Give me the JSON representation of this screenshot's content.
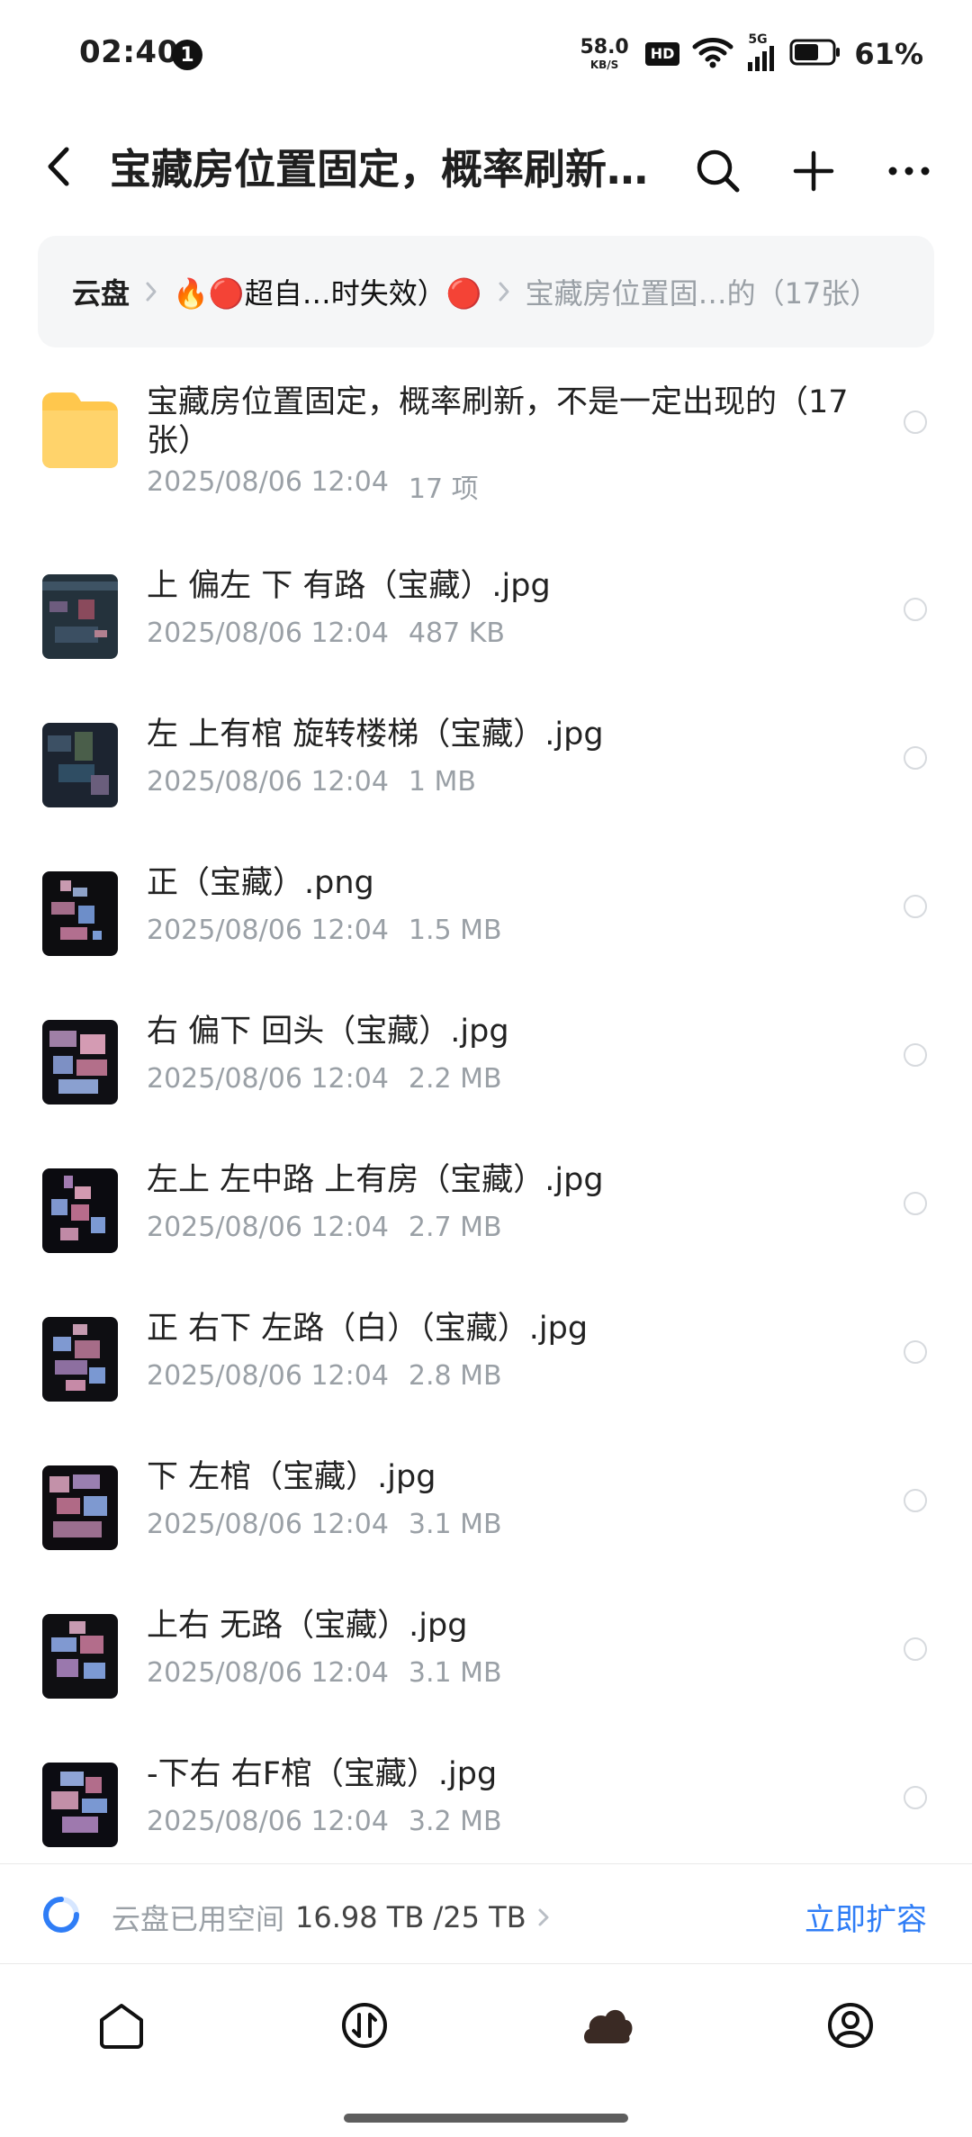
{
  "status_bar": {
    "time": "02:40",
    "notification_badge": "1",
    "net_speed_value": "58.0",
    "net_speed_unit": "KB/S",
    "hd_badge": "HD",
    "cellular_label": "5G",
    "battery_percent": "61%"
  },
  "header": {
    "title": "宝藏房位置固定，概率刷新…",
    "icons": {
      "back": "back-chevron-icon",
      "search": "search-icon",
      "add": "plus-icon",
      "more": "more-horizontal-icon"
    }
  },
  "breadcrumb": {
    "root": "云盘",
    "middle": "🔥🔴超自…时失效）🔴",
    "current": "宝藏房位置固…的（17张）"
  },
  "files": [
    {
      "type": "folder",
      "name": "宝藏房位置固定，概率刷新，不是一定出现的（17张）",
      "date": "2025/08/06 12:04",
      "info": "17 项"
    },
    {
      "type": "image",
      "name": "上 偏左 下 有路（宝藏）.jpg",
      "date": "2025/08/06 12:04",
      "info": "487 KB"
    },
    {
      "type": "image",
      "name": "左 上有棺 旋转楼梯（宝藏）.jpg",
      "date": "2025/08/06 12:04",
      "info": "1 MB"
    },
    {
      "type": "image",
      "name": "正（宝藏）.png",
      "date": "2025/08/06 12:04",
      "info": "1.5 MB"
    },
    {
      "type": "image",
      "name": "右 偏下 回头（宝藏）.jpg",
      "date": "2025/08/06 12:04",
      "info": "2.2 MB"
    },
    {
      "type": "image",
      "name": "左上 左中路 上有房（宝藏）.jpg",
      "date": "2025/08/06 12:04",
      "info": "2.7 MB"
    },
    {
      "type": "image",
      "name": "正 右下 左路（白）（宝藏）.jpg",
      "date": "2025/08/06 12:04",
      "info": "2.8 MB"
    },
    {
      "type": "image",
      "name": "下 左棺（宝藏）.jpg",
      "date": "2025/08/06 12:04",
      "info": "3.1 MB"
    },
    {
      "type": "image",
      "name": "上右 无路（宝藏）.jpg",
      "date": "2025/08/06 12:04",
      "info": "3.1 MB"
    },
    {
      "type": "image",
      "name": "-下右 右F棺（宝藏）.jpg",
      "date": "2025/08/06 12:04",
      "info": "3.2 MB"
    }
  ],
  "storage": {
    "label": "云盘已用空间",
    "value": "16.98 TB /25 TB",
    "action": "立即扩容"
  },
  "bottom_nav": {
    "items": [
      "home-icon",
      "transfer-icon",
      "cloud-icon",
      "profile-icon"
    ],
    "active": "cloud-icon"
  },
  "colors": {
    "accent": "#2f7df6",
    "muted_text": "#9aa0a6",
    "folder": "#ffc74d"
  }
}
